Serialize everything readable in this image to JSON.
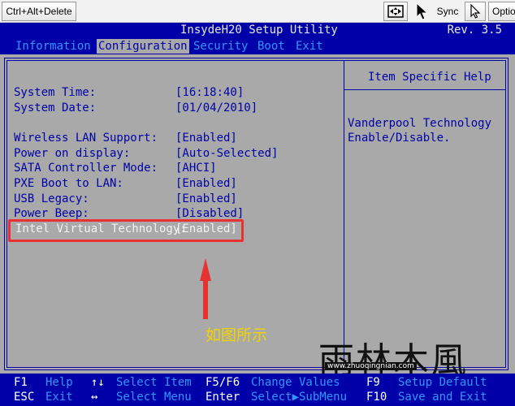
{
  "toolbar": {
    "ctrl_alt_delete": "Ctrl+Alt+Delete",
    "sync": "Sync",
    "options": "Optio"
  },
  "bios": {
    "title": "InsydeH20 Setup Utility",
    "revision": "Rev. 3.5",
    "menu": [
      "Information",
      "Configuration",
      "Security",
      "Boot",
      "Exit"
    ],
    "active_menu": "Configuration",
    "settings": [
      {
        "label": "System Time:",
        "value": "[16:18:40]"
      },
      {
        "label": "System Date:",
        "value": "[01/04/2010]"
      },
      {
        "label": "Wireless LAN Support:",
        "value": "[Enabled]"
      },
      {
        "label": "Power on display:",
        "value": "[Auto-Selected]"
      },
      {
        "label": "SATA Controller Mode:",
        "value": "[AHCI]"
      },
      {
        "label": "PXE Boot to LAN:",
        "value": "[Enabled]"
      },
      {
        "label": "USB Legacy:",
        "value": "[Enabled]"
      },
      {
        "label": "Power Beep:",
        "value": "[Disabled]"
      },
      {
        "label": "Intel Virtual Technology:",
        "value": "[Enabled]"
      }
    ],
    "help": {
      "title": "Item Specific Help",
      "line1": "Vanderpool Technology",
      "line2": "Enable/Disable."
    },
    "footer": {
      "row1": [
        {
          "key": "F1",
          "desc": "Help"
        },
        {
          "key": "↑↓",
          "desc": "Select Item"
        },
        {
          "key": "F5/F6",
          "desc": "Change Values"
        },
        {
          "key": "F9",
          "desc": "Setup Default"
        }
      ],
      "row2": [
        {
          "key": "ESC",
          "desc": "Exit"
        },
        {
          "key": "↔",
          "desc": "Select Menu"
        },
        {
          "key": "Enter",
          "desc": "Select▶SubMenu"
        },
        {
          "key": "F10",
          "desc": "Save and Exit"
        }
      ]
    }
  },
  "annotation": {
    "text": "如图所示",
    "color": "#f0d400",
    "highlight_color": "#e83232"
  },
  "watermark": {
    "text": "雨林木風",
    "url": "www.zhuoqingnian.com"
  },
  "colors": {
    "bios_blue": "#0000a8",
    "bios_gray": "#a9a9a9",
    "menu_text": "#2f98ff"
  }
}
